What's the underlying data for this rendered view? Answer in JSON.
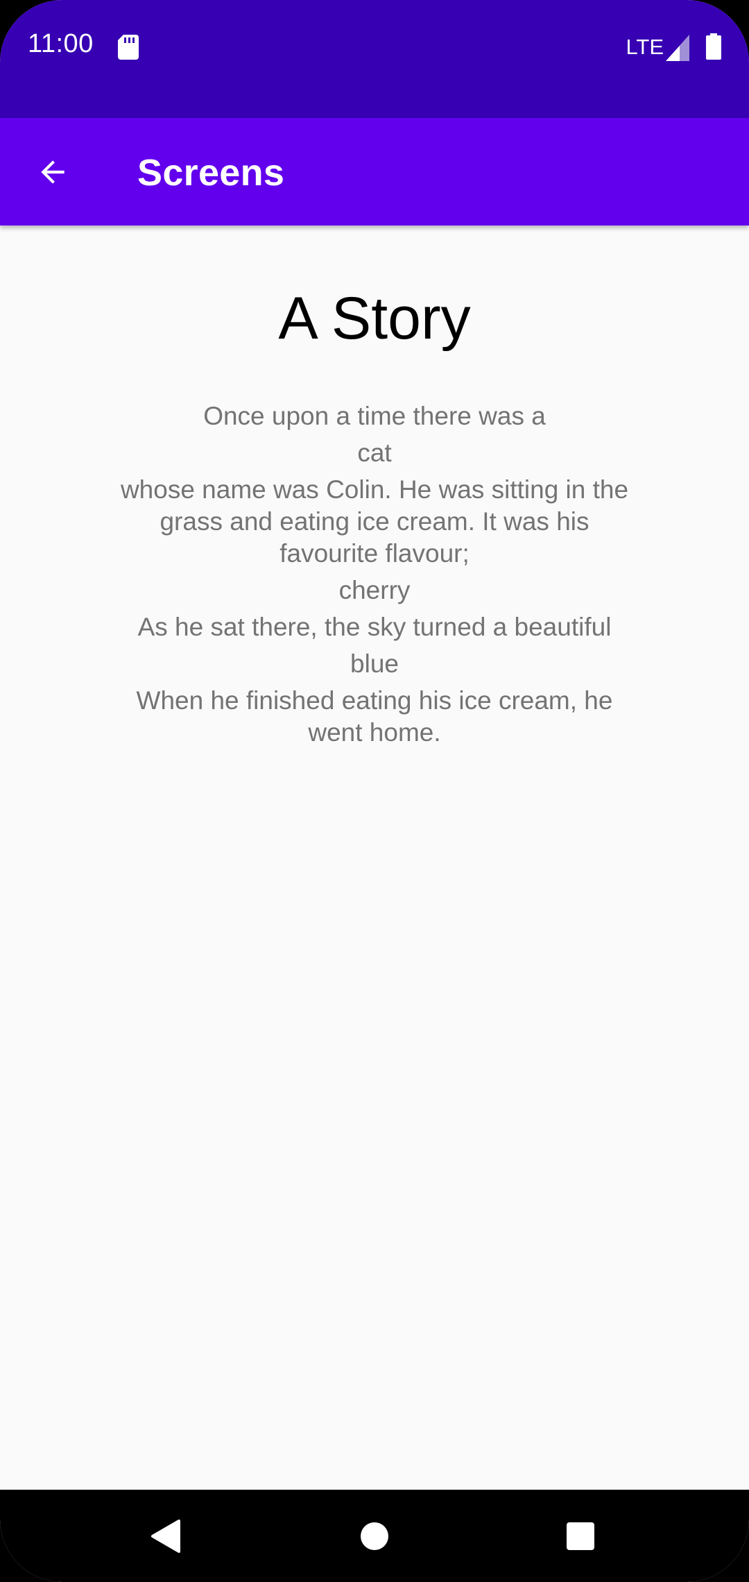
{
  "status_bar": {
    "time": "11:00",
    "network": "LTE",
    "icons": [
      "sd-card-icon",
      "signal-icon",
      "battery-icon"
    ]
  },
  "app_bar": {
    "title": "Screens",
    "back_icon": "arrow-back-icon"
  },
  "story": {
    "title": "A Story",
    "lines": [
      "Once upon a time there was a",
      "cat",
      "whose name was Colin. He was sitting in the grass and eating ice cream. It was his favourite flavour;",
      "cherry",
      "As he sat there, the sky turned a beautiful",
      "blue",
      "When he finished eating his ice cream, he went home."
    ]
  },
  "nav_bar": {
    "back": "nav-back-icon",
    "home": "nav-home-icon",
    "recents": "nav-recents-icon"
  },
  "colors": {
    "status_bar": "#3700b3",
    "app_bar": "#6200ee",
    "background": "#fafafa",
    "body_text": "#737373"
  }
}
